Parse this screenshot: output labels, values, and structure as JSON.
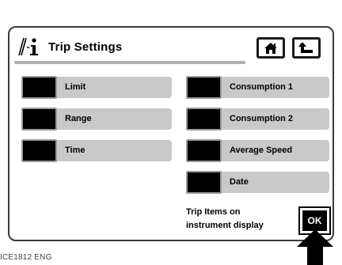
{
  "header": {
    "title": "Trip  Settings",
    "icon": "trip-info-icon",
    "home_icon": "home-icon",
    "back_icon": "back-arrow-icon"
  },
  "items": {
    "left": [
      {
        "label": "Limit"
      },
      {
        "label": "Range"
      },
      {
        "label": "Time"
      }
    ],
    "right": [
      {
        "label": "Consumption 1"
      },
      {
        "label": "Consumption 2"
      },
      {
        "label": "Average Speed"
      },
      {
        "label": "Date"
      }
    ]
  },
  "footer": {
    "line1": "Trip Items on",
    "line2": "instrument display",
    "ok_label": "OK"
  },
  "caption": "ICE1812 ENG",
  "colors": {
    "item_bg": "#c9c9c9",
    "box": "#000000",
    "border": "#3a3a3a"
  }
}
